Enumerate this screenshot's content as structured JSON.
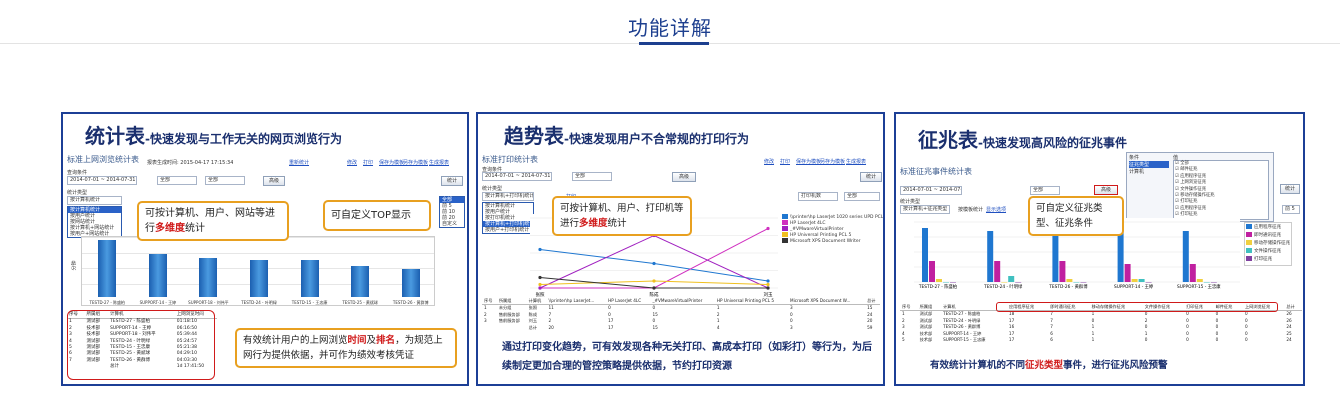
{
  "page_title": "功能详解",
  "panels": {
    "stats": {
      "heading_main": "统计表",
      "heading_sub": "-快速发现与工作无关的网页浏览行为",
      "window_title": "标准上网浏览统计表",
      "report_time": "报表生成时间: 2015-04-17 17:15:34",
      "reset_link": "重新统计",
      "top_links": [
        "修改",
        "打印",
        "保存为模板",
        "另存为模板",
        "生成报表"
      ],
      "query_label": "查询条件",
      "date_range": "2014-07-01 ~ 2014-07-31",
      "target": "全部",
      "type": "全部",
      "advanced_btn": "高级",
      "stat_btn": "统计",
      "stat_type_label": "统计类型",
      "stat_type_value": "按计算机统计",
      "stat_menu": [
        "按计算机统计",
        "按用户统计",
        "按网站统计",
        "按计算机+网站统计",
        "按用户+网站统计"
      ],
      "top_menu": [
        "全部",
        "前 5",
        "前 10",
        "前 20",
        "自定义"
      ],
      "callout_1": {
        "before": "可按计算机、用户、网站等进行",
        "em": "多维度",
        "after": "统计"
      },
      "callout_2": "可自定义TOP显示",
      "callout_3": {
        "a": "有效统计用户的上网浏览",
        "em1": "时间",
        "b": "及",
        "em2": "排名",
        "c": "，为规范上网行为提供依据，并可作为绩效考核凭证"
      },
      "table_headers": [
        "序号",
        "所属组",
        "计算机",
        "上网浏览时间"
      ],
      "table_rows": [
        [
          "1",
          "测试部",
          "TESTD-27 - 陈盛柏",
          "01:18:10"
        ],
        [
          "2",
          "技术部",
          "SUPPORT-14 - 王婷",
          "06:16:50"
        ],
        [
          "3",
          "技术部",
          "SUPPORT-18 - 刘伟平",
          "05:39:44"
        ],
        [
          "4",
          "测试部",
          "TESTD-24 - 叶明绿",
          "05:24:57"
        ],
        [
          "5",
          "测试部",
          "TESTD-15 - 王忠康",
          "05:21:38"
        ],
        [
          "6",
          "测试部",
          "TESTD-25 - 黄斌球",
          "04:29:10"
        ],
        [
          "7",
          "测试部",
          "TESTD-26 - 黄群博",
          "04:03:30"
        ],
        [
          "",
          "",
          "总计",
          "1d 17:41:50"
        ]
      ]
    },
    "trend": {
      "heading_main": "趋势表",
      "heading_sub": "-快速发现用户不合常规的打印行为",
      "window_title": "标准打印统计表",
      "top_links": [
        "修改",
        "打印",
        "保存为模板",
        "另存为模板",
        "生成报表"
      ],
      "query_label": "查询条件",
      "date_range": "2014-07-01 ~ 2014-07-31",
      "target": "全部",
      "advanced_btn": "高级",
      "stat_btn": "统计",
      "stat_type_label": "统计类型",
      "stat_type_value": "按计算机+打印机统计",
      "print_link": "打印",
      "stat_menu": [
        "按计算机统计",
        "按用户统计",
        "按打印机统计",
        "按计算机+打印机统计",
        "按用户+打印机统计"
      ],
      "print_mode": "打印机数",
      "print_scope": "全部",
      "callout": {
        "before": "可按计算机、用户、打印机等进行",
        "em": "多维度",
        "after": "统计"
      },
      "legend": [
        "\\\\printer\\hp LaserJet 1020 series UPD PCL 5",
        "HP LaserJet 4LC",
        "_#VMwareVirtualPrinter",
        "HP Universal Printing PCL 5",
        "Microsoft XPS Document Writer"
      ],
      "table_headers": [
        "序号",
        "所属组",
        "计算机",
        "\\\\printer\\hp LaserJet...",
        "HP LaserJet 4LC",
        "_#VMwareVirtualPrinter",
        "HP Universal Printing PCL 5",
        "Microsoft XPS Document W...",
        "总计"
      ],
      "table_rows": [
        [
          "1",
          "未分组",
          "张照",
          "11",
          "0",
          "0",
          "1",
          "3",
          "15"
        ],
        [
          "2",
          "售前服务部",
          "陈成",
          "7",
          "0",
          "15",
          "2",
          "0",
          "24"
        ],
        [
          "3",
          "售前服务部",
          "刘玉",
          "2",
          "17",
          "0",
          "1",
          "0",
          "20"
        ],
        [
          "",
          "",
          "总计",
          "20",
          "17",
          "15",
          "4",
          "3",
          "59"
        ]
      ],
      "caption": "通过打印变化趋势，可有效发现各种无关打印、高成本打印（如彩打）等行为，为后续制定更加合理的管控策略提供依据，节约打印资源"
    },
    "alert": {
      "heading_main": "征兆表",
      "heading_sub": "-快速发现高风险的征兆事件",
      "window_title": "标准征兆事件统计表",
      "date_range": "2014-07-01 ~ 2014-07-31",
      "target": "全部",
      "advanced_btn": "高级",
      "stat_btn": "统计",
      "stat_type_label": "统计类型",
      "stat_type_value": "按计算机+征兆类型",
      "stat_links": [
        "按模板统计",
        "显示选项"
      ],
      "filter_headers": [
        "条件",
        "值"
      ],
      "filter_rows": [
        "征兆类型",
        "计算机"
      ],
      "check_items": [
        "全部",
        "邮件征兆",
        "应用程序征兆",
        "上网浏览征兆",
        "文件操作征兆",
        "移动存储操作征兆",
        "打印征兆",
        "应用程序征兆",
        "打印征兆"
      ],
      "top_value": "前 5",
      "callout": "可自定义征兆类型、征兆条件",
      "legend": [
        "应用程序征兆",
        "即时通讯征兆",
        "移动存储操作征兆",
        "文件操作征兆",
        "打印征兆"
      ],
      "table_headers": [
        "序号",
        "所属组",
        "计算机",
        "应用程序征兆",
        "即时通讯征兆",
        "移动存储操作征兆",
        "文件操作征兆",
        "打印征兆",
        "邮件征兆",
        "上网浏览征兆",
        "总计"
      ],
      "table_rows": [
        [
          "1",
          "测试部",
          "TESTD-27 - 陈盛柏",
          "18",
          "7",
          "1",
          "0",
          "0",
          "0",
          "0",
          "26"
        ],
        [
          "2",
          "测试部",
          "TESTD-24 - 叶明绿",
          "17",
          "7",
          "0",
          "2",
          "0",
          "0",
          "0",
          "26"
        ],
        [
          "3",
          "测试部",
          "TESTD-26 - 黄群博",
          "16",
          "7",
          "1",
          "0",
          "0",
          "0",
          "0",
          "24"
        ],
        [
          "4",
          "技术部",
          "SUPPORT-14 - 王婷",
          "17",
          "6",
          "1",
          "1",
          "0",
          "0",
          "0",
          "25"
        ],
        [
          "5",
          "技术部",
          "SUPPORT-15 - 王忠康",
          "17",
          "6",
          "1",
          "0",
          "0",
          "0",
          "0",
          "24"
        ]
      ],
      "caption_before": "有效统计计算机的不同",
      "caption_em": "征兆类型",
      "caption_after": "事件，进行征兆风险预警"
    }
  },
  "chart_data": [
    {
      "type": "bar",
      "categories": [
        "TESTD-27 - 陈盛柏",
        "SUPPORT-14 - 王婷",
        "SUPPORT-18 - 刘伟平",
        "TESTD-24 - 叶明绿",
        "TESTD-15 - 王忠康",
        "TESTD-25 - 黄斌球",
        "TESTD-26 - 黄群博"
      ],
      "values": [
        8.3,
        6.3,
        5.7,
        5.4,
        5.4,
        4.5,
        4.1
      ],
      "ylabel": "分钟"
    },
    {
      "type": "line",
      "categories": [
        "张照",
        "陈成",
        "刘玉"
      ],
      "series": [
        {
          "name": "\\\\printer\\hp LaserJet 1020 series UPD PCL 5",
          "values": [
            11,
            7,
            2
          ],
          "color": "#1f77d0"
        },
        {
          "name": "HP LaserJet 4LC",
          "values": [
            0,
            0,
            17
          ],
          "color": "#d030c0"
        },
        {
          "name": "_#VMwareVirtualPrinter",
          "values": [
            0,
            15,
            0
          ],
          "color": "#a020c0"
        },
        {
          "name": "HP Universal Printing PCL 5",
          "values": [
            1,
            2,
            1
          ],
          "color": "#f0c020"
        },
        {
          "name": "Microsoft XPS Document Writer",
          "values": [
            3,
            0,
            0
          ],
          "color": "#333333"
        }
      ],
      "ylim": [
        0,
        20
      ]
    },
    {
      "type": "bar",
      "categories": [
        "TESTD-27 - 陈盛柏",
        "TESTD-24 - 叶明绿",
        "TESTD-26 - 黄群博",
        "SUPPORT-14 - 王婷",
        "SUPPORT-15 - 王忠康"
      ],
      "series": [
        {
          "name": "应用程序征兆",
          "values": [
            18,
            17,
            16,
            17,
            17
          ],
          "color": "#1f77d0"
        },
        {
          "name": "即时通讯征兆",
          "values": [
            7,
            7,
            7,
            6,
            6
          ],
          "color": "#c020a0"
        },
        {
          "name": "移动存储操作征兆",
          "values": [
            1,
            0,
            1,
            1,
            1
          ],
          "color": "#f0d040"
        },
        {
          "name": "文件操作征兆",
          "values": [
            0,
            2,
            0,
            1,
            0
          ],
          "color": "#40c0c0"
        },
        {
          "name": "打印征兆",
          "values": [
            0,
            0,
            0,
            0,
            0
          ],
          "color": "#8040a0"
        }
      ],
      "ylim": [
        0,
        20
      ]
    }
  ]
}
